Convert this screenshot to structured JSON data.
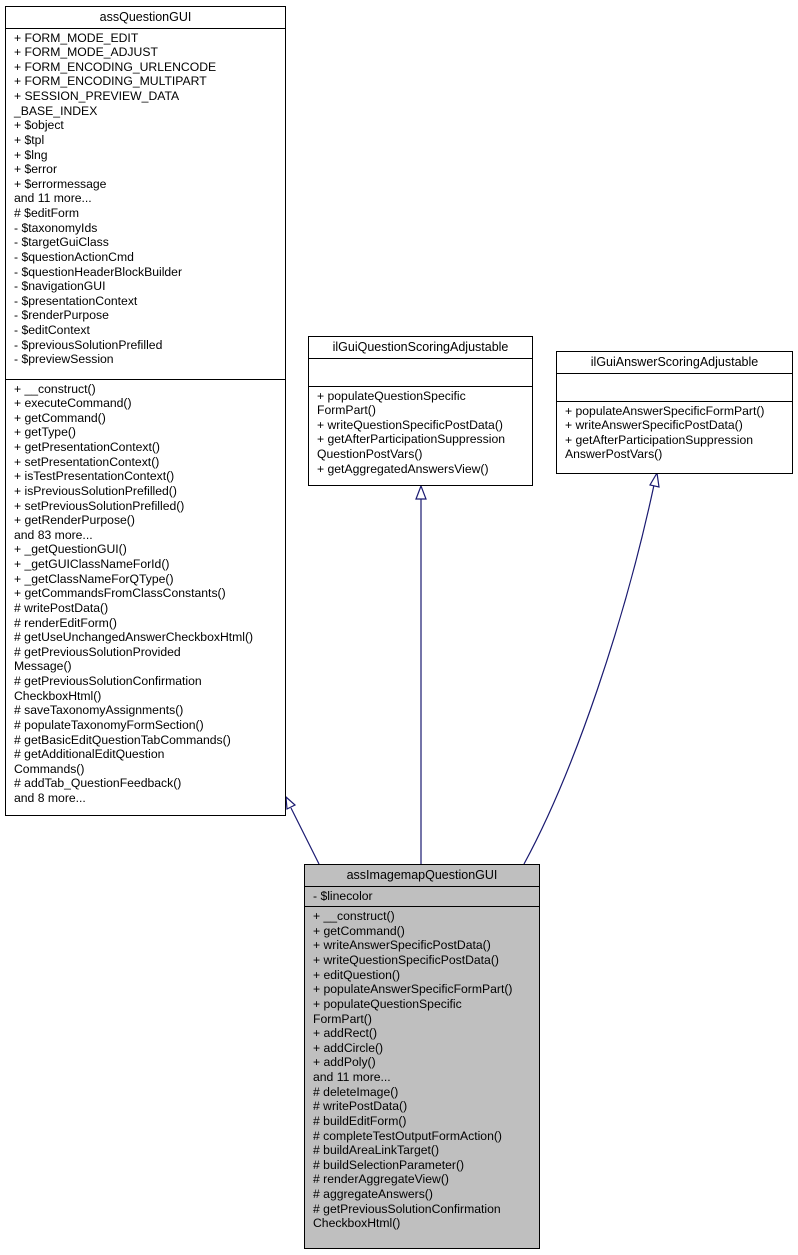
{
  "diagram": {
    "type": "class-inheritance",
    "edge_color": "#191970",
    "focus_fill": "#bfbfbf",
    "classes": {
      "base": {
        "name": "assQuestionGUI",
        "attributes": [
          "+ FORM_MODE_EDIT",
          "+ FORM_MODE_ADJUST",
          "+ FORM_ENCODING_URLENCODE",
          "+ FORM_ENCODING_MULTIPART",
          "+ SESSION_PREVIEW_DATA",
          "_BASE_INDEX",
          "+ $object",
          "+ $tpl",
          "+ $lng",
          "+ $error",
          "+ $errormessage",
          "and 11 more...",
          "# $editForm",
          "- $taxonomyIds",
          "- $targetGuiClass",
          "- $questionActionCmd",
          "- $questionHeaderBlockBuilder",
          "- $navigationGUI",
          "- $presentationContext",
          "- $renderPurpose",
          "- $editContext",
          "- $previousSolutionPrefilled",
          "- $previewSession"
        ],
        "methods": [
          "+ __construct()",
          "+ executeCommand()",
          "+ getCommand()",
          "+ getType()",
          "+ getPresentationContext()",
          "+ setPresentationContext()",
          "+ isTestPresentationContext()",
          "+ isPreviousSolutionPrefilled()",
          "+ setPreviousSolutionPrefilled()",
          "+ getRenderPurpose()",
          "and 83 more...",
          "+ _getQuestionGUI()",
          "+ _getGUIClassNameForId()",
          "+ _getClassNameForQType()",
          "+ getCommandsFromClassConstants()",
          "# writePostData()",
          "# renderEditForm()",
          "# getUseUnchangedAnswerCheckboxHtml()",
          "# getPreviousSolutionProvided",
          "Message()",
          "# getPreviousSolutionConfirmation",
          "CheckboxHtml()",
          "# saveTaxonomyAssignments()",
          "# populateTaxonomyFormSection()",
          "# getBasicEditQuestionTabCommands()",
          "# getAdditionalEditQuestion",
          "Commands()",
          "# addTab_QuestionFeedback()",
          "and 8 more..."
        ]
      },
      "question_iface": {
        "name": "ilGuiQuestionScoringAdjustable",
        "attributes": [],
        "methods": [
          "+ populateQuestionSpecific",
          "FormPart()",
          "+ writeQuestionSpecificPostData()",
          "+ getAfterParticipationSuppression",
          "QuestionPostVars()",
          "+ getAggregatedAnswersView()"
        ]
      },
      "answer_iface": {
        "name": "ilGuiAnswerScoringAdjustable",
        "attributes": [],
        "methods": [
          "+ populateAnswerSpecificFormPart()",
          "+ writeAnswerSpecificPostData()",
          "+ getAfterParticipationSuppression",
          "AnswerPostVars()"
        ]
      },
      "focus": {
        "name": "assImagemapQuestionGUI",
        "attributes": [
          "- $linecolor"
        ],
        "methods": [
          "+ __construct()",
          "+ getCommand()",
          "+ writeAnswerSpecificPostData()",
          "+ writeQuestionSpecificPostData()",
          "+ editQuestion()",
          "+ populateAnswerSpecificFormPart()",
          "+ populateQuestionSpecific",
          "FormPart()",
          "+ addRect()",
          "+ addCircle()",
          "+ addPoly()",
          "and 11 more...",
          "# deleteImage()",
          "# writePostData()",
          "# buildEditForm()",
          "# completeTestOutputFormAction()",
          "# buildAreaLinkTarget()",
          "# buildSelectionParameter()",
          "# renderAggregateView()",
          "# aggregateAnswers()",
          "# getPreviousSolutionConfirmation",
          "CheckboxHtml()"
        ]
      }
    },
    "edges": [
      {
        "from": "assImagemapQuestionGUI",
        "to": "assQuestionGUI",
        "kind": "inherits"
      },
      {
        "from": "assImagemapQuestionGUI",
        "to": "ilGuiQuestionScoringAdjustable",
        "kind": "inherits"
      },
      {
        "from": "assImagemapQuestionGUI",
        "to": "ilGuiAnswerScoringAdjustable",
        "kind": "inherits"
      }
    ]
  }
}
